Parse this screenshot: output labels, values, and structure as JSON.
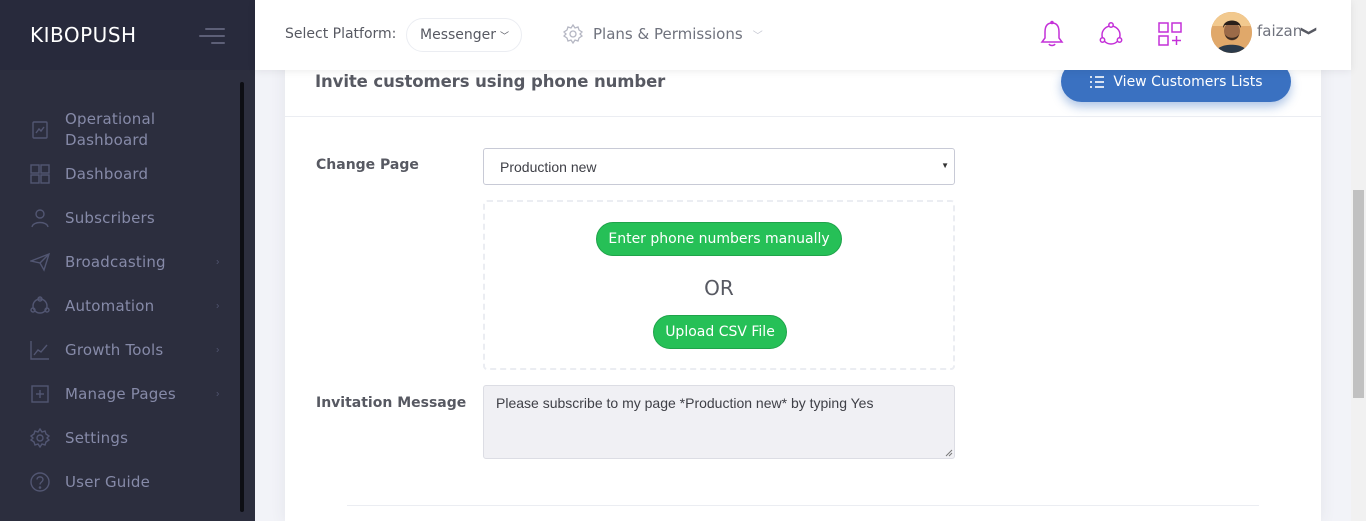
{
  "sidebar": {
    "brand": "KIBOPUSH",
    "items": [
      {
        "label": "Operational Dashboard",
        "icon": "chart-doc-icon",
        "has_submenu": false
      },
      {
        "label": "Dashboard",
        "icon": "grid-icon",
        "has_submenu": false
      },
      {
        "label": "Subscribers",
        "icon": "user-icon",
        "has_submenu": false
      },
      {
        "label": "Broadcasting",
        "icon": "paper-plane-icon",
        "has_submenu": true
      },
      {
        "label": "Automation",
        "icon": "network-icon",
        "has_submenu": true
      },
      {
        "label": "Growth Tools",
        "icon": "line-chart-icon",
        "has_submenu": true
      },
      {
        "label": "Manage Pages",
        "icon": "add-page-icon",
        "has_submenu": true
      },
      {
        "label": "Settings",
        "icon": "gear-icon",
        "has_submenu": false
      },
      {
        "label": "User Guide",
        "icon": "question-icon",
        "has_submenu": false
      }
    ]
  },
  "header": {
    "platform_label": "Select Platform:",
    "platform_value": "Messenger",
    "plans_label": "Plans & Permissions",
    "user_name": "faizan",
    "icons": [
      "bell-icon",
      "share-network-icon",
      "apps-add-icon"
    ],
    "icon_color": "#c430d8"
  },
  "card": {
    "title": "Invite customers using phone number",
    "view_button": "View Customers Lists",
    "change_page_label": "Change Page",
    "selected_page": "Production new",
    "manual_button": "Enter phone numbers manually",
    "or_text": "OR",
    "upload_button": "Upload CSV File",
    "invitation_label": "Invitation Message",
    "invitation_message": "Please subscribe to my page *Production new* by typing Yes"
  },
  "colors": {
    "sidebar_bg": "#2c2e3e",
    "primary": "#3a71c1",
    "success": "#26c057"
  }
}
